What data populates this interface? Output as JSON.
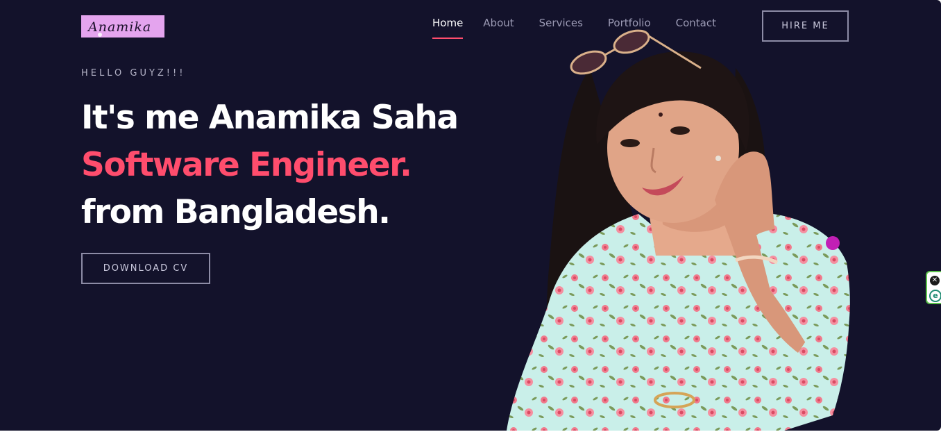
{
  "logo": {
    "text": "Anamika"
  },
  "nav": {
    "items": [
      {
        "label": "Home",
        "active": true
      },
      {
        "label": "About",
        "active": false
      },
      {
        "label": "Services",
        "active": false
      },
      {
        "label": "Portfolio",
        "active": false
      },
      {
        "label": "Contact",
        "active": false
      }
    ],
    "hire_label": "HIRE ME"
  },
  "hero": {
    "greeting": "HELLO GUYZ!!!",
    "line1": "It's me Anamika Saha",
    "line2": "Software Engineer.",
    "line3": "from Bangladesh.",
    "cv_label": "DOWNLOAD CV"
  },
  "extension": {
    "close_icon": "close-icon",
    "app_icon": "e"
  },
  "colors": {
    "background": "#13122b",
    "accent": "#ff4d6d",
    "logo_bg": "#e4a4ee",
    "muted_text": "#9b9ab4",
    "dress": "#c8f0ec"
  }
}
